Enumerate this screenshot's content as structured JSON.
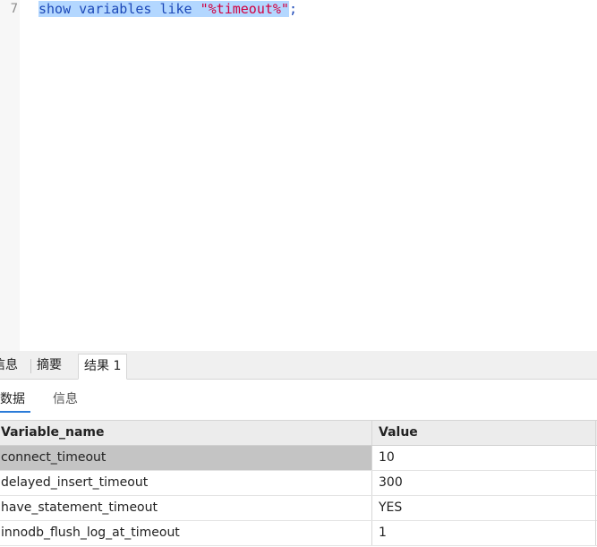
{
  "editor": {
    "line_number": "7",
    "code": {
      "kw1": "show",
      "kw2": "variables",
      "kw3": "like",
      "string": "\"%timeout%\"",
      "semicolon": ";"
    }
  },
  "tabs": [
    {
      "label": "信息"
    },
    {
      "label": "摘要"
    },
    {
      "label": "结果 1"
    }
  ],
  "subtabs": [
    {
      "label": "数据"
    },
    {
      "label": "信息"
    }
  ],
  "grid": {
    "columns": [
      "Variable_name",
      "Value"
    ],
    "rows": [
      {
        "name": "connect_timeout",
        "value": "10"
      },
      {
        "name": "delayed_insert_timeout",
        "value": "300"
      },
      {
        "name": "have_statement_timeout",
        "value": "YES"
      },
      {
        "name": "innodb_flush_log_at_timeout",
        "value": "1"
      }
    ]
  }
}
